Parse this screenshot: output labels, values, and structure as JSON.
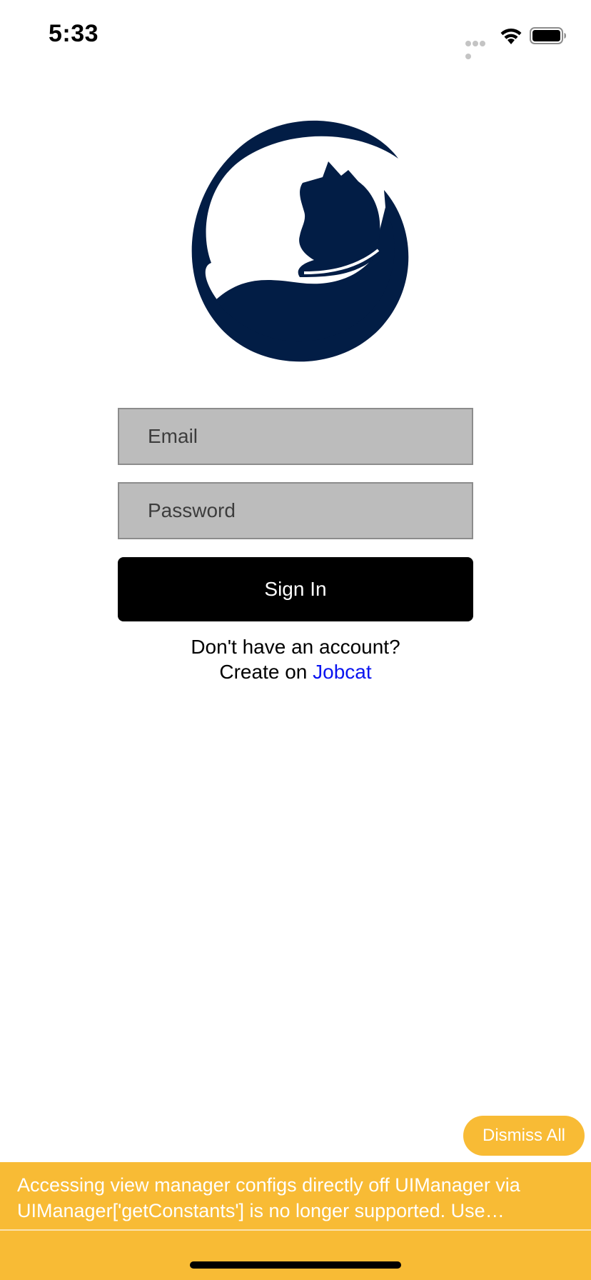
{
  "status_bar": {
    "time": "5:33",
    "icons": [
      "signal-dots-icon",
      "wifi-icon",
      "battery-icon"
    ]
  },
  "logo": {
    "icon": "cat-crescent-logo-icon",
    "color": "#021d45"
  },
  "form": {
    "email_placeholder": "Email",
    "password_placeholder": "Password",
    "sign_in_label": "Sign In"
  },
  "signup": {
    "prompt_line1": "Don't have an account?",
    "prompt_prefix": "Create on ",
    "link_label": "Jobcat",
    "link_color": "#0a14f0"
  },
  "warnings": {
    "dismiss_label": "Dismiss All",
    "message": "Accessing view manager configs directly off UIManager via UIManager['getConstants'] is no longer supported. Use UIManager.getViewManagerConfig('…') instead.",
    "accent_color": "#f8bb35"
  }
}
